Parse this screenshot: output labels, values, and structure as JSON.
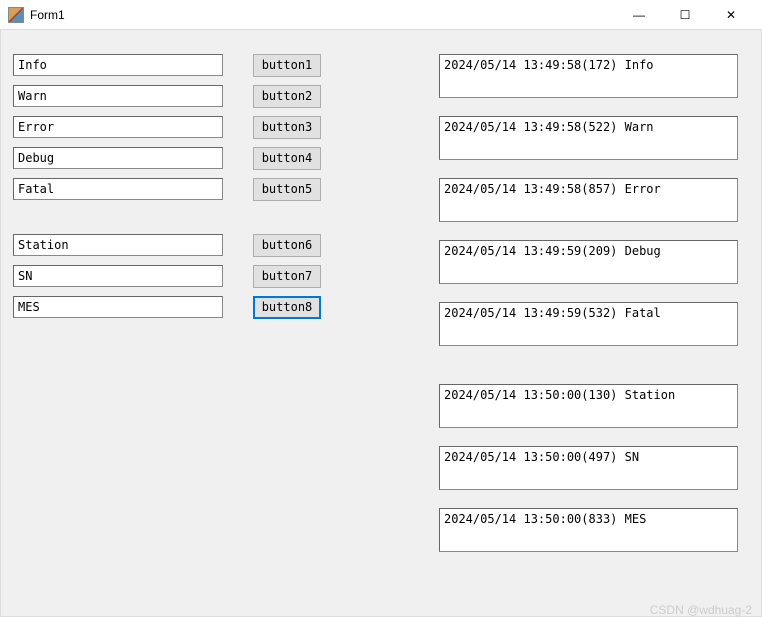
{
  "window": {
    "title": "Form1",
    "minimize": "—",
    "maximize": "☐",
    "close": "✕"
  },
  "inputs": {
    "group1": [
      "Info",
      "Warn",
      "Error",
      "Debug",
      "Fatal"
    ],
    "group2": [
      "Station",
      "SN",
      "MES"
    ]
  },
  "buttons": {
    "group1": [
      "button1",
      "button2",
      "button3",
      "button4",
      "button5"
    ],
    "group2": [
      "button6",
      "button7",
      "button8"
    ]
  },
  "logs": [
    "2024/05/14 13:49:58(172) Info",
    "2024/05/14 13:49:58(522) Warn",
    "2024/05/14 13:49:58(857) Error",
    "2024/05/14 13:49:59(209) Debug",
    "2024/05/14 13:49:59(532) Fatal",
    "2024/05/14 13:50:00(130) Station",
    "2024/05/14 13:50:00(497) SN",
    "2024/05/14 13:50:00(833) MES"
  ],
  "watermark": "CSDN @wdhuag-2"
}
